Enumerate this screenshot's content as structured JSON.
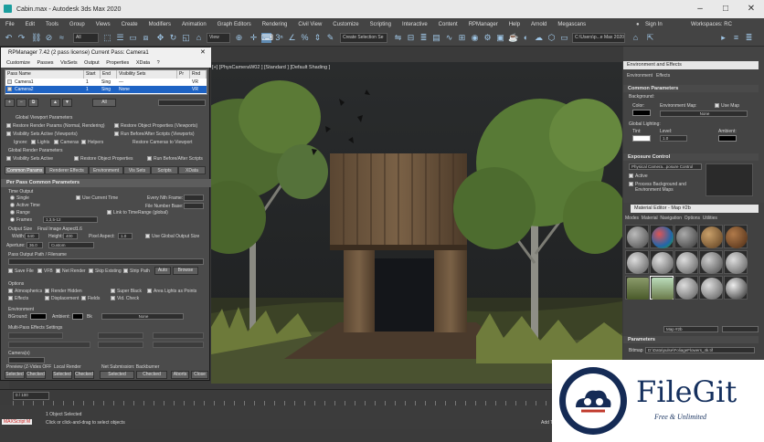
{
  "window": {
    "title": "Cabin.max - Autodesk 3ds Max 2020"
  },
  "menubar": [
    "File",
    "Edit",
    "Tools",
    "Group",
    "Views",
    "Create",
    "Modifiers",
    "Animation",
    "Graph Editors",
    "Rendering",
    "Civil View",
    "Customize",
    "Scripting",
    "Interactive",
    "Content",
    "RPManager",
    "Help",
    "Arnold",
    "Megascans"
  ],
  "signin": "Sign In",
  "workspaces": "Workspaces: RC",
  "toolbar": {
    "filter": "All",
    "view": "View",
    "selection_set": "Create Selection Se",
    "path": "C:\\Users\\p...e Max 2020"
  },
  "viewport": {
    "label": "[+] [PhysCameraW02 ] [Standard ] [Default Shading ]"
  },
  "rpm": {
    "title": "RPManager 7.42 (2 pass license) Current Pass: Camera1",
    "menu": [
      "Customize",
      "Passes",
      "VisSets",
      "Output",
      "Properties",
      "XData",
      "?"
    ],
    "columns": [
      "Pass Name",
      "Start",
      "End",
      "Visibility Sets",
      "Pr",
      "Rnd"
    ],
    "passes": [
      {
        "name": "Camera1",
        "start": "1",
        "end": "Sing",
        "vis": "---",
        "pr": "",
        "rnd": "VR"
      },
      {
        "name": "Camera2",
        "start": "1",
        "end": "Sing",
        "vis": "None",
        "pr": "",
        "rnd": "VR"
      }
    ],
    "global_viewport": "Global Viewport Parameters",
    "restore_render": "Restore Render Params (Normal, Rendering)",
    "restore_objects": "Restore Object Properties (Viewports)",
    "visibility_sets_active": "Visibility Sets Active (Viewports)",
    "run_before_after": "Run Before/After Scripts (Viewports)",
    "ignore": "Ignore:",
    "lights": "Lights",
    "cameras": "Cameras",
    "helpers": "Helpers",
    "restore_cameras": "Restore Cameras to Viewport",
    "global_render": "Global Render Parameters",
    "vis_active": "Visibility Sets Active",
    "restore_obj": "Restore Object Properties",
    "run_scripts": "Run Before/After Scripts",
    "tabs": [
      "Common Params",
      "Renderer Effects",
      "Environment",
      "Vis Sets",
      "Scripts",
      "XData"
    ],
    "per_pass": "Per Pass Common Parameters",
    "time_output": "Time Output",
    "single": "Single",
    "active_time": "Active Time",
    "range": "Range",
    "frames": "Frames",
    "frames_value": "1,3,5-12",
    "use_current_time": "Use Current Time",
    "every_nth": "Every Nth Frame:",
    "file_number_base": "File Number Base:",
    "link_time_range": "Link to TimeRange (global)",
    "output_size": "Output Size",
    "final_aspect": "Final Image Aspect:",
    "final_aspect_value": "1.6",
    "width": "Width:",
    "width_value": "640",
    "height": "Height:",
    "height_value": "400",
    "pixel_aspect": "Pixel Aspect:",
    "pixel_aspect_value": "1.0",
    "use_global_output": "Use Global Output Size",
    "aperture": "Aperture:",
    "aperture_value": "36.0",
    "custom": "Custom",
    "pass_output_path": "Pass Output Path / Filename",
    "save_file": "Save File",
    "vfb": "VFB",
    "net_render": "Net Render",
    "skip_existing": "Skip Existing",
    "strip_path": "Strip Path",
    "auto": "Auto",
    "browse": "Browse",
    "options": "Options",
    "atmospherics": "Atmospherics",
    "render_hidden": "Render Hidden",
    "super_black": "Super Black",
    "area_lights": "Area Lights as Points",
    "effects": "Effects",
    "displacement": "Displacement",
    "fields": "Fields",
    "vid_check": "Vid. Check",
    "environment": "Environment",
    "background": "BGround:",
    "ambient": "Ambient:",
    "bk": "Bk",
    "none": "None",
    "multipass": "Multi-Pass Effects Settings",
    "camera": "Camera(s)",
    "selected": "Selected",
    "checked": "Checked",
    "aborts": "Aborts",
    "close": "Close",
    "preview": "Preview (Z-Vides OFF",
    "local_render": "Local Render",
    "net_submission": "Net Submission: Backburner"
  },
  "env": {
    "title": "Environment and Effects",
    "tabs": [
      "Environment",
      "Effects"
    ],
    "common": "Common Parameters",
    "background": "Background:",
    "color": "Color:",
    "environment_map": "Environment Map:",
    "use_map": "Use Map",
    "none": "None",
    "global_lighting": "Global Lighting:",
    "tint": "Tint:",
    "level": "Level:",
    "level_value": "1.0",
    "ambient": "Ambient:",
    "exposure": "Exposure Control",
    "exposure_value": "Physical Camera...posure Control",
    "active": "Active",
    "process_bg": "Process Background and Environment Maps"
  },
  "mated": {
    "title": "Material Editor - Map #2b",
    "menu": [
      "Modes",
      "Material",
      "Navigation",
      "Options",
      "Utilities"
    ],
    "map_name": "Map #2b",
    "bitmap_label": "Bitmap",
    "bitmap_path": "D:\\Data\\pulse\\FoliageFlowers_4k.tif",
    "parameters": "Parameters"
  },
  "status": {
    "objects": "1 Object Selected",
    "hint": "Click or click-and-drag to select objects",
    "maxscript": "MAXScript M",
    "frame": "0 / 100",
    "add_time_tag": "Add T"
  },
  "watermark": {
    "brand": "FileGit",
    "tagline": "Free & Unlimited"
  },
  "colors": {
    "accent": "#1e63c4",
    "panel": "#444444",
    "viewport": "#26282a",
    "brand": "#15305e"
  }
}
